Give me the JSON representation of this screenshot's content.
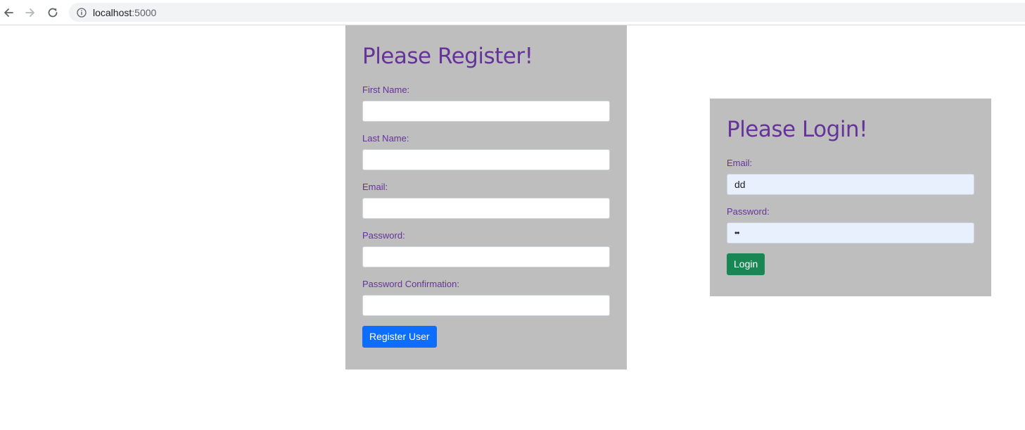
{
  "browser": {
    "url_host": "localhost",
    "url_port": ":5000",
    "back_icon": "arrow-left-icon",
    "forward_icon": "arrow-right-icon",
    "reload_icon": "reload-icon",
    "info_icon": "info-icon"
  },
  "register": {
    "title": "Please Register!",
    "fields": [
      {
        "label": "First Name:",
        "value": ""
      },
      {
        "label": "Last Name:",
        "value": ""
      },
      {
        "label": "Email:",
        "value": ""
      },
      {
        "label": "Password:",
        "value": ""
      },
      {
        "label": "Password Confirmation:",
        "value": ""
      }
    ],
    "button_label": "Register User"
  },
  "login": {
    "title": "Please Login!",
    "fields": [
      {
        "label": "Email:",
        "value": "dd"
      },
      {
        "label": "Password:",
        "value": "••"
      }
    ],
    "button_label": "Login"
  },
  "colors": {
    "accent_text": "#663399",
    "card_bg": "#bebebe",
    "primary_button": "#0d6efd",
    "success_button": "#198754",
    "autofill_bg": "#e8f0fe"
  }
}
